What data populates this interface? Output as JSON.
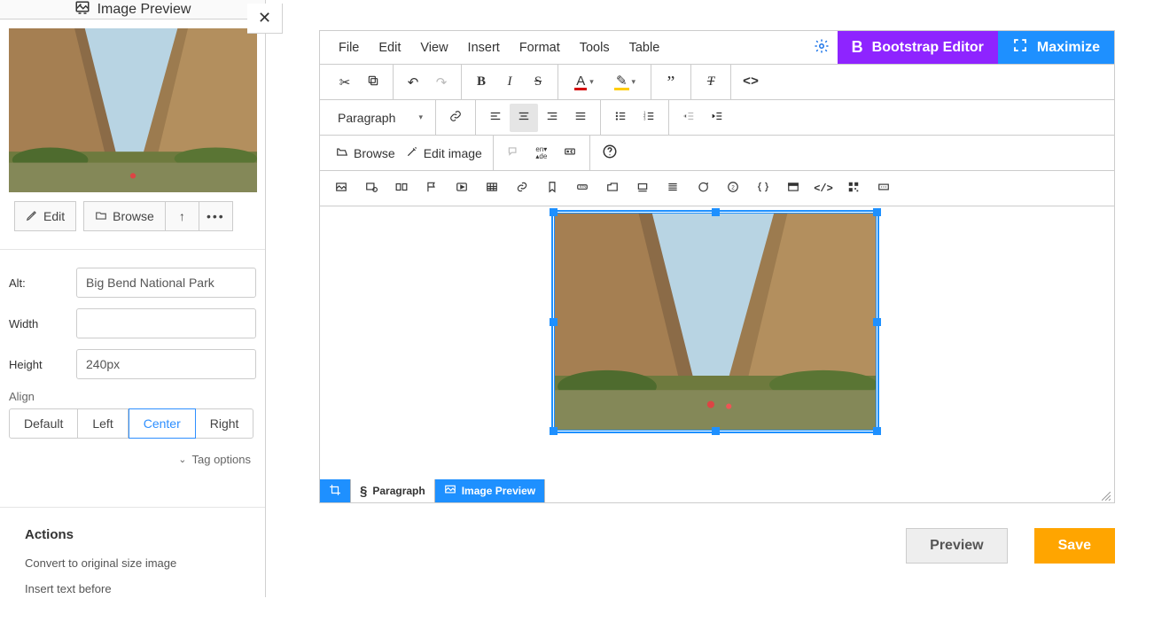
{
  "sidebar": {
    "title": "Image Preview",
    "edit_label": "Edit",
    "browse_label": "Browse",
    "fields": {
      "alt_label": "Alt:",
      "alt_value": "Big Bend National Park",
      "width_label": "Width",
      "width_value": "",
      "height_label": "Height",
      "height_value": "240px",
      "align_label": "Align"
    },
    "align_options": {
      "default": "Default",
      "left": "Left",
      "center": "Center",
      "right": "Right"
    },
    "tag_options": "Tag options",
    "actions_heading": "Actions",
    "actions": {
      "convert": "Convert to original size image",
      "insert_before": "Insert text before"
    }
  },
  "menu": {
    "file": "File",
    "edit": "Edit",
    "view": "View",
    "insert": "Insert",
    "format": "Format",
    "tools": "Tools",
    "table": "Table"
  },
  "topbuttons": {
    "bootstrap": "Bootstrap Editor",
    "maximize": "Maximize"
  },
  "toolbars": {
    "para": "Paragraph",
    "browse": "Browse",
    "edit_image": "Edit image"
  },
  "pathbar": {
    "paragraph": "Paragraph",
    "image_preview": "Image Preview"
  },
  "footer": {
    "preview": "Preview",
    "save": "Save"
  }
}
